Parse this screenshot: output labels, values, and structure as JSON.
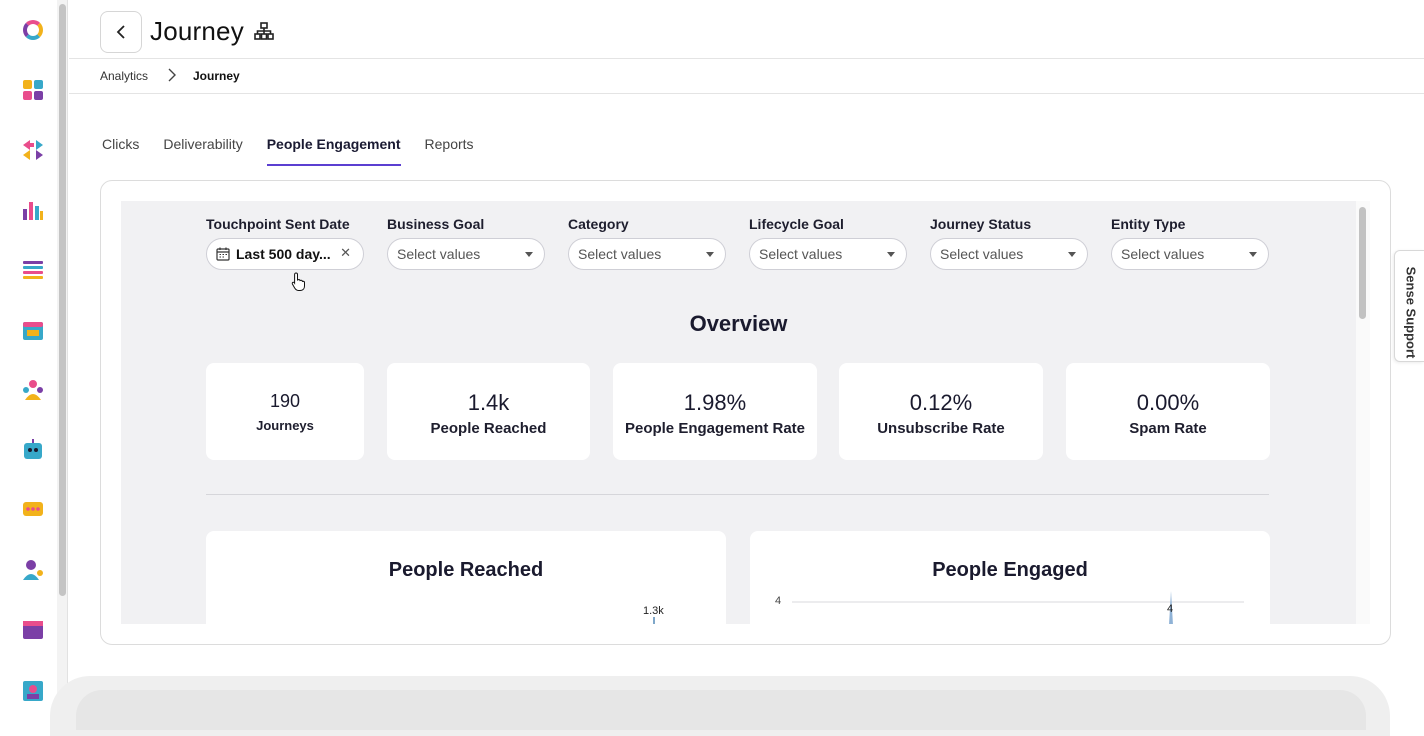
{
  "header": {
    "title": "Journey"
  },
  "breadcrumb": {
    "parent": "Analytics",
    "current": "Journey"
  },
  "tabs": [
    {
      "label": "Clicks",
      "active": false
    },
    {
      "label": "Deliverability",
      "active": false
    },
    {
      "label": "People Engagement",
      "active": true
    },
    {
      "label": "Reports",
      "active": false
    }
  ],
  "filters": {
    "touchpoint": {
      "label": "Touchpoint Sent Date",
      "value": "Last 500 day..."
    },
    "business_goal": {
      "label": "Business Goal",
      "placeholder": "Select values"
    },
    "category": {
      "label": "Category",
      "placeholder": "Select values"
    },
    "lifecycle_goal": {
      "label": "Lifecycle Goal",
      "placeholder": "Select values"
    },
    "journey_status": {
      "label": "Journey Status",
      "placeholder": "Select values"
    },
    "entity_type": {
      "label": "Entity Type",
      "placeholder": "Select values"
    }
  },
  "overview": {
    "title": "Overview",
    "kpis": [
      {
        "value": "190",
        "label": "Journeys"
      },
      {
        "value": "1.4k",
        "label": "People Reached"
      },
      {
        "value": "1.98%",
        "label": "People Engagement Rate"
      },
      {
        "value": "0.12%",
        "label": "Unsubscribe Rate"
      },
      {
        "value": "0.00%",
        "label": "Spam Rate"
      }
    ]
  },
  "charts": {
    "people_reached": {
      "title": "People Reached",
      "peak_label": "1.3k"
    },
    "people_engaged": {
      "title": "People Engaged",
      "y_tick": "4",
      "peak_label": "4"
    }
  },
  "support": {
    "label": "Sense Support"
  },
  "colors": {
    "accent": "#5b3fd1",
    "canvas": "#f1f1f3"
  }
}
